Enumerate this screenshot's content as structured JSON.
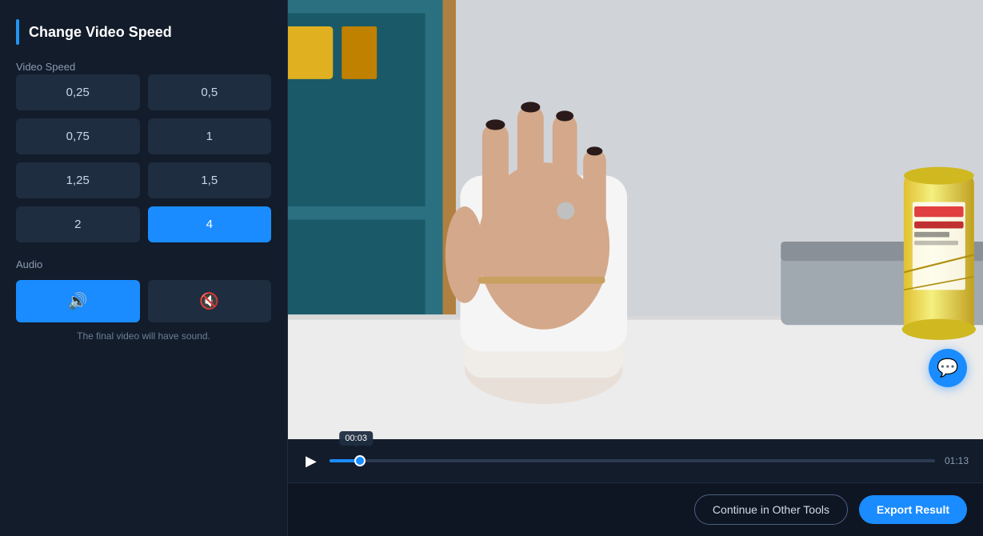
{
  "sidebar": {
    "title": "Change Video Speed",
    "accent_color": "#2196f3",
    "speed_section_label": "Video Speed",
    "speed_buttons": [
      {
        "label": "0,25",
        "value": 0.25,
        "active": false
      },
      {
        "label": "0,5",
        "value": 0.5,
        "active": false
      },
      {
        "label": "0,75",
        "value": 0.75,
        "active": false
      },
      {
        "label": "1",
        "value": 1,
        "active": false
      },
      {
        "label": "1,25",
        "value": 1.25,
        "active": false
      },
      {
        "label": "1,5",
        "value": 1.5,
        "active": false
      },
      {
        "label": "2",
        "value": 2,
        "active": false
      },
      {
        "label": "4",
        "value": 4,
        "active": true
      }
    ],
    "audio_section_label": "Audio",
    "audio_on_icon": "🔊",
    "audio_off_icon": "🔇",
    "audio_hint": "The final video will have sound."
  },
  "player": {
    "current_time": "00:03",
    "duration": "01:13",
    "progress_percent": 5
  },
  "footer": {
    "continue_label": "Continue in Other Tools",
    "export_label": "Export Result"
  }
}
